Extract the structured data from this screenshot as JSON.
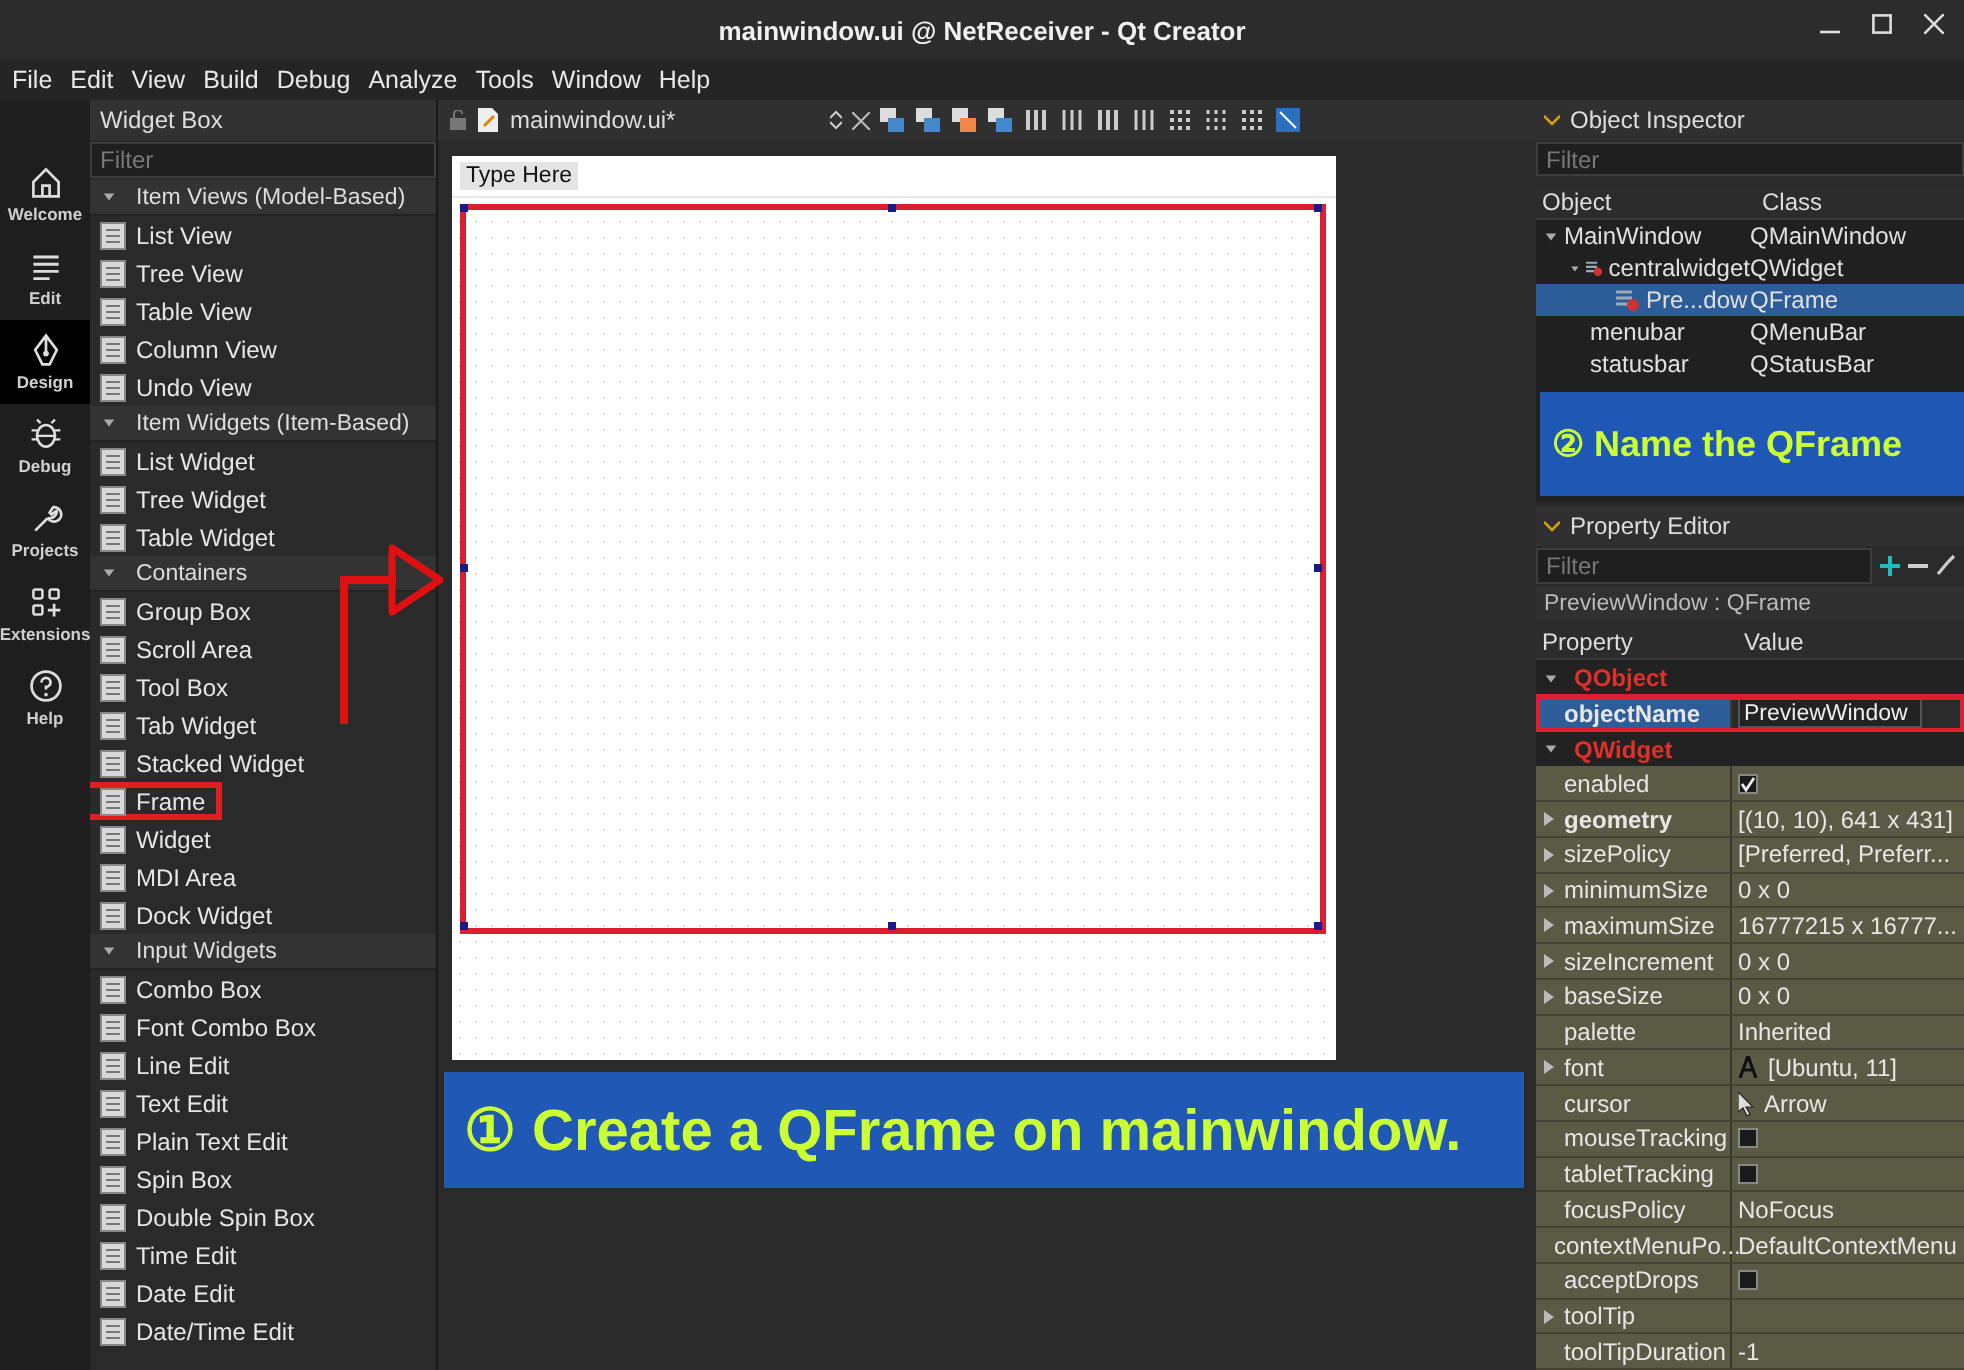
{
  "window": {
    "title": "mainwindow.ui @ NetReceiver - Qt Creator"
  },
  "menu_bar": [
    "File",
    "Edit",
    "View",
    "Build",
    "Debug",
    "Analyze",
    "Tools",
    "Window",
    "Help"
  ],
  "modes": [
    {
      "label": "Welcome",
      "selected": false
    },
    {
      "label": "Edit",
      "selected": false
    },
    {
      "label": "Design",
      "selected": true
    },
    {
      "label": "Debug",
      "selected": false
    },
    {
      "label": "Projects",
      "selected": false
    },
    {
      "label": "Extensions",
      "selected": false
    },
    {
      "label": "Help",
      "selected": false
    }
  ],
  "widget_box": {
    "title": "Widget Box",
    "filter": {
      "placeholder": "Filter"
    },
    "groups": [
      {
        "title": "Item Views (Model-Based)",
        "expanded": true,
        "items": [
          {
            "label": "List View",
            "outlined": false
          },
          {
            "label": "Tree View",
            "outlined": false
          },
          {
            "label": "Table View",
            "outlined": false
          },
          {
            "label": "Column View",
            "outlined": false
          },
          {
            "label": "Undo View",
            "outlined": false
          }
        ]
      },
      {
        "title": "Item Widgets (Item-Based)",
        "expanded": true,
        "items": [
          {
            "label": "List Widget",
            "outlined": false
          },
          {
            "label": "Tree Widget",
            "outlined": false
          },
          {
            "label": "Table Widget",
            "outlined": false
          }
        ]
      },
      {
        "title": "Containers",
        "expanded": true,
        "items": [
          {
            "label": "Group Box",
            "outlined": false
          },
          {
            "label": "Scroll Area",
            "outlined": false
          },
          {
            "label": "Tool Box",
            "outlined": false
          },
          {
            "label": "Tab Widget",
            "outlined": false
          },
          {
            "label": "Stacked Widget",
            "outlined": false
          },
          {
            "label": "Frame",
            "outlined": true
          },
          {
            "label": "Widget",
            "outlined": false
          },
          {
            "label": "MDI Area",
            "outlined": false
          },
          {
            "label": "Dock Widget",
            "outlined": false
          }
        ]
      },
      {
        "title": "Input Widgets",
        "expanded": true,
        "items": [
          {
            "label": "Combo Box",
            "outlined": false
          },
          {
            "label": "Font Combo Box",
            "outlined": false
          },
          {
            "label": "Line Edit",
            "outlined": false
          },
          {
            "label": "Text Edit",
            "outlined": false
          },
          {
            "label": "Plain Text Edit",
            "outlined": false
          },
          {
            "label": "Spin Box",
            "outlined": false
          },
          {
            "label": "Double Spin Box",
            "outlined": false
          },
          {
            "label": "Time Edit",
            "outlined": false
          },
          {
            "label": "Date Edit",
            "outlined": false
          },
          {
            "label": "Date/Time Edit",
            "outlined": false
          }
        ]
      }
    ]
  },
  "editor": {
    "file_tab": "mainwindow.ui*",
    "form": {
      "menu_placeholder": "Type Here",
      "frame": {
        "selected": true,
        "outlined": true
      }
    }
  },
  "object_inspector": {
    "title": "Object Inspector",
    "filter": {
      "placeholder": "Filter"
    },
    "columns": [
      "Object",
      "Class"
    ],
    "tree": [
      {
        "name": "MainWindow",
        "class": "QMainWindow",
        "expanded": true,
        "selected": false,
        "children": [
          {
            "name": "centralwidget",
            "class": "QWidget",
            "kind": "widget",
            "expanded": true,
            "selected": false,
            "children": [
              {
                "name": "Pre...dow",
                "class": "QFrame",
                "kind": "widget",
                "selected": true
              }
            ]
          },
          {
            "name": "menubar",
            "class": "QMenuBar",
            "selected": false
          },
          {
            "name": "statusbar",
            "class": "QStatusBar",
            "selected": false
          }
        ]
      }
    ]
  },
  "property_editor": {
    "title": "Property Editor",
    "filter": {
      "placeholder": "Filter"
    },
    "subtitle": "PreviewWindow : QFrame",
    "columns": [
      "Property",
      "Value"
    ],
    "rows": [
      {
        "kind": "category",
        "name": "QObject",
        "expanded": true
      },
      {
        "kind": "text",
        "name": "objectName",
        "value": "PreviewWindow",
        "expandable": false,
        "bold": true,
        "selected": true,
        "outlined": true
      },
      {
        "kind": "category",
        "name": "QWidget",
        "expanded": true
      },
      {
        "kind": "checkbox",
        "name": "enabled",
        "checked": true,
        "expandable": false,
        "bold": false,
        "selected": false,
        "outlined": false
      },
      {
        "kind": "text",
        "name": "geometry",
        "value": "[(10, 10), 641 x 431]",
        "expandable": true,
        "bold": true,
        "selected": false,
        "outlined": false
      },
      {
        "kind": "text",
        "name": "sizePolicy",
        "value": "[Preferred, Preferr...",
        "expandable": true,
        "bold": false,
        "selected": false,
        "outlined": false
      },
      {
        "kind": "text",
        "name": "minimumSize",
        "value": "0 x 0",
        "expandable": true,
        "bold": false,
        "selected": false,
        "outlined": false
      },
      {
        "kind": "text",
        "name": "maximumSize",
        "value": "16777215 x 16777...",
        "expandable": true,
        "bold": false,
        "selected": false,
        "outlined": false
      },
      {
        "kind": "text",
        "name": "sizeIncrement",
        "value": "0 x 0",
        "expandable": true,
        "bold": false,
        "selected": false,
        "outlined": false
      },
      {
        "kind": "text",
        "name": "baseSize",
        "value": "0 x 0",
        "expandable": true,
        "bold": false,
        "selected": false,
        "outlined": false
      },
      {
        "kind": "text",
        "name": "palette",
        "value": "Inherited",
        "expandable": false,
        "bold": false,
        "selected": false,
        "outlined": false
      },
      {
        "kind": "font",
        "name": "font",
        "value": "[Ubuntu, 11]",
        "expandable": true,
        "bold": false,
        "selected": false,
        "outlined": false
      },
      {
        "kind": "cursor",
        "name": "cursor",
        "value": "Arrow",
        "expandable": false,
        "bold": false,
        "selected": false,
        "outlined": false
      },
      {
        "kind": "checkbox",
        "name": "mouseTracking",
        "checked": false,
        "expandable": false,
        "bold": false,
        "selected": false,
        "outlined": false
      },
      {
        "kind": "checkbox",
        "name": "tabletTracking",
        "checked": false,
        "expandable": false,
        "bold": false,
        "selected": false,
        "outlined": false
      },
      {
        "kind": "text",
        "name": "focusPolicy",
        "value": "NoFocus",
        "expandable": false,
        "bold": false,
        "selected": false,
        "outlined": false
      },
      {
        "kind": "text",
        "name": "contextMenuPo...",
        "value": "DefaultContextMenu",
        "expandable": false,
        "bold": false,
        "selected": false,
        "outlined": false
      },
      {
        "kind": "checkbox",
        "name": "acceptDrops",
        "checked": false,
        "expandable": false,
        "bold": false,
        "selected": false,
        "outlined": false
      },
      {
        "kind": "text",
        "name": "toolTip",
        "expandable": true,
        "bold": false,
        "selected": false,
        "outlined": false
      },
      {
        "kind": "text",
        "name": "toolTipDuration",
        "value": "-1",
        "expandable": false,
        "bold": false,
        "selected": false,
        "outlined": false
      }
    ]
  },
  "annotations": [
    {
      "text": "② Name the QFrame"
    },
    {
      "text": "① Create a QFrame on mainwindow."
    }
  ]
}
